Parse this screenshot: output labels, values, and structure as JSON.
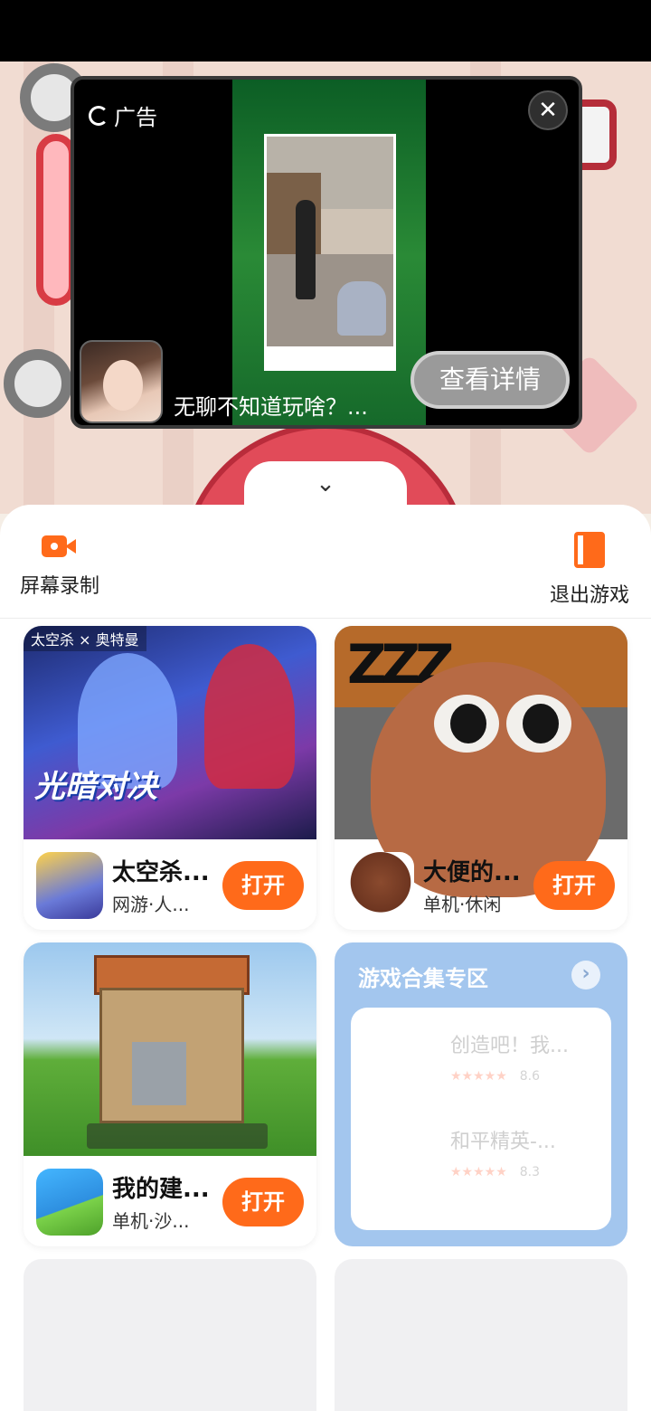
{
  "ad": {
    "label": "广告",
    "close_glyph": "✕",
    "headline": "无聊不知道玩啥？...",
    "detail_button": "查看详情"
  },
  "collapse_glyph": "⌄",
  "actions": {
    "record_label": "屏幕录制",
    "exit_label": "退出游戏"
  },
  "games": [
    {
      "name": "太空杀...",
      "subtitle": "网游·人...",
      "button": "打开",
      "banner_title": "光暗对决",
      "banner_tag": "太空杀 × 奥特曼",
      "icon": "space-kill-icon"
    },
    {
      "name": "大便的...",
      "subtitle": "单机·休闲",
      "button": "打开",
      "banner_text": "ZZZ",
      "icon": "pou-icon"
    },
    {
      "name": "我的建...",
      "subtitle": "单机·沙...",
      "button": "打开",
      "icon": "builder-icon"
    }
  ],
  "collection": {
    "title": "游戏合集专区",
    "arrow_glyph": "›",
    "items": [
      {
        "name": "创造吧！我...",
        "stars": "★★★★★",
        "score": "8.6"
      },
      {
        "name": "和平精英-...",
        "stars": "★★★★★",
        "score": "8.3"
      }
    ]
  },
  "colors": {
    "accent": "#ff6a1a",
    "collection_bg": "#a3c6ee"
  }
}
